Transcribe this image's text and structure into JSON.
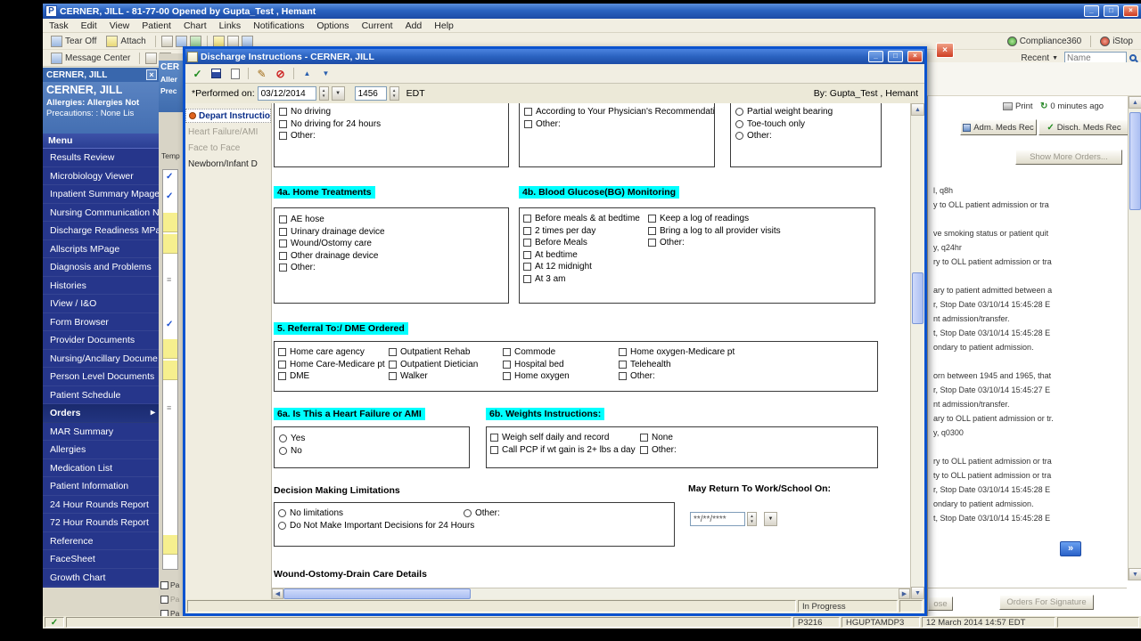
{
  "window": {
    "app_icon_letter": "P",
    "title": "CERNER, JILL - 81-77-00 Opened by Gupta_Test , Hemant",
    "menu_items": [
      "Task",
      "Edit",
      "View",
      "Patient",
      "Chart",
      "Links",
      "Notifications",
      "Options",
      "Current",
      "Add",
      "Help"
    ],
    "toolbar": {
      "tear_off": "Tear Off",
      "attach": "Attach",
      "compliance": "Compliance360",
      "istop": "iStop",
      "message_center": "Message Center",
      "recent": "Recent",
      "name_placeholder": "Name"
    },
    "statusbar": {
      "terminal": "P3216",
      "host": "HGUPTAMDP3",
      "datetime": "12 March 2014  14:57 EDT"
    }
  },
  "patient_panel": {
    "tab_name": "CERNER, JILL",
    "name": "CERNER, JILL",
    "allergies": "Allergies: Allergies Not",
    "precautions": "Precautions: : None Lis"
  },
  "nav_menu": {
    "header": "Menu",
    "items": [
      {
        "label": "Results Review"
      },
      {
        "label": "Microbiology Viewer"
      },
      {
        "label": "Inpatient Summary Mpage"
      },
      {
        "label": "Nursing Communication N"
      },
      {
        "label": "Discharge Readiness MPa"
      },
      {
        "label": "Allscripts MPage"
      },
      {
        "label": "Diagnosis and Problems"
      },
      {
        "label": "Histories"
      },
      {
        "label": "IView / I&O"
      },
      {
        "label": "Form Browser"
      },
      {
        "label": "Provider Documents"
      },
      {
        "label": "Nursing/Ancillary Docume"
      },
      {
        "label": "Person Level Documents"
      },
      {
        "label": "Patient Schedule"
      },
      {
        "label": "Orders",
        "cls": "selected"
      },
      {
        "label": "MAR Summary"
      },
      {
        "label": "Allergies"
      },
      {
        "label": "Medication List"
      },
      {
        "label": "Patient Information"
      },
      {
        "label": "24 Hour Rounds Report"
      },
      {
        "label": "72 Hour Rounds Report"
      },
      {
        "label": "Reference"
      },
      {
        "label": "FaceSheet"
      },
      {
        "label": "Growth Chart"
      }
    ]
  },
  "strip": {
    "banner_lines": [
      "CER",
      "Aller",
      "Prec"
    ],
    "temp_label": "Temp",
    "pa_labels": [
      "Pa",
      "Pa",
      "Pa"
    ]
  },
  "dialog": {
    "title": "Discharge Instructions - CERNER, JILL",
    "performed": {
      "label": "*Performed on:",
      "date": "03/12/2014",
      "time": "1456",
      "tz": "EDT"
    },
    "by_label": "By:",
    "by_value": "Gupta_Test , Hemant",
    "nav_items": [
      {
        "label": "Depart Instruction",
        "cls": "selected"
      },
      {
        "label": "Heart Failure/AMI",
        "cls": "disabled"
      },
      {
        "label": "Face to Face",
        "cls": "disabled"
      },
      {
        "label": "Newborn/Infant D"
      }
    ],
    "form": {
      "driving": {
        "options": [
          "No driving",
          "No driving for 24 hours",
          "Other:"
        ]
      },
      "physician": {
        "options": [
          "According to Your Physician's Recommendations",
          "Other:"
        ]
      },
      "weight_bearing": {
        "options": [
          "Partial weight bearing",
          "Toe-touch only",
          "Other:"
        ]
      },
      "s4a": {
        "title": "4a. Home Treatments",
        "options": [
          "AE hose",
          "Urinary drainage device",
          "Wound/Ostomy care",
          "Other drainage device",
          "Other:"
        ]
      },
      "s4b": {
        "title": "4b. Blood Glucose(BG) Monitoring",
        "col1": [
          "Before meals & at bedtime",
          "2 times per day",
          "Before Meals",
          "At bedtime",
          "At 12 midnight",
          "At 3 am"
        ],
        "col2": [
          "Keep a log of readings",
          "Bring a log to all provider visits",
          "Other:"
        ]
      },
      "s5": {
        "title": "5. Referral To:/ DME Ordered",
        "col1": [
          "Home care agency",
          "Home Care-Medicare pt",
          "DME"
        ],
        "col2": [
          "Outpatient Rehab",
          "Outpatient Dietician",
          "Walker"
        ],
        "col3": [
          "Commode",
          "Hospital bed",
          "Home oxygen"
        ],
        "col4": [
          "Home oxygen-Medicare pt",
          "Telehealth",
          "Other:"
        ]
      },
      "s6a": {
        "title": "6a. Is This a Heart Failure or AMI",
        "options": [
          "Yes",
          "No"
        ]
      },
      "s6b": {
        "title": "6b. Weights Instructions:",
        "col1": [
          "Weigh self daily and record",
          "Call PCP if wt gain is 2+ lbs a day"
        ],
        "col2": [
          "None",
          "Other:"
        ]
      },
      "decision": {
        "title": "Decision Making Limitations",
        "col1": [
          "No limitations",
          "Do Not Make Important Decisions for 24 Hours"
        ],
        "col2": [
          "Other:"
        ]
      },
      "return_on": {
        "title": "May Return To Work/School On:",
        "value": "**/**/****"
      },
      "wound_title": "Wound-Ostomy-Drain Care Details"
    },
    "status": "In Progress"
  },
  "right_panel": {
    "print_label": "Print",
    "refresh_label": "0 minutes ago",
    "adm_meds": "Adm. Meds Rec",
    "disch_meds": "Disch. Meds Rec",
    "show_more": "Show More Orders...",
    "order_fragments": [
      "l, q8h",
      "y to OLL patient admission or tra",
      "",
      "ve smoking status or patient quit",
      "y, q24hr",
      "ry to OLL patient admission or tra",
      "",
      "ary to patient admitted between a",
      "r, Stop Date 03/10/14 15:45:28 E",
      "nt admission/transfer.",
      "t, Stop Date 03/10/14 15:45:28 E",
      "ondary to patient admission.",
      "",
      "orn between 1945 and 1965, that",
      "r, Stop Date 03/10/14 15:45:27 E",
      "nt admission/transfer.",
      "ary to OLL patient admission or tr.",
      "y, q0300",
      "",
      "ry to OLL patient admission or tra",
      "ty to OLL patient admission or tra",
      "r, Stop Date 03/10/14 15:45:28 E",
      "ondary to patient admission.",
      "t, Stop Date 03/10/14 15:45:28 E"
    ],
    "expand": "»",
    "close_fragment": "ose",
    "orders_for_signature": "Orders For Signature"
  }
}
